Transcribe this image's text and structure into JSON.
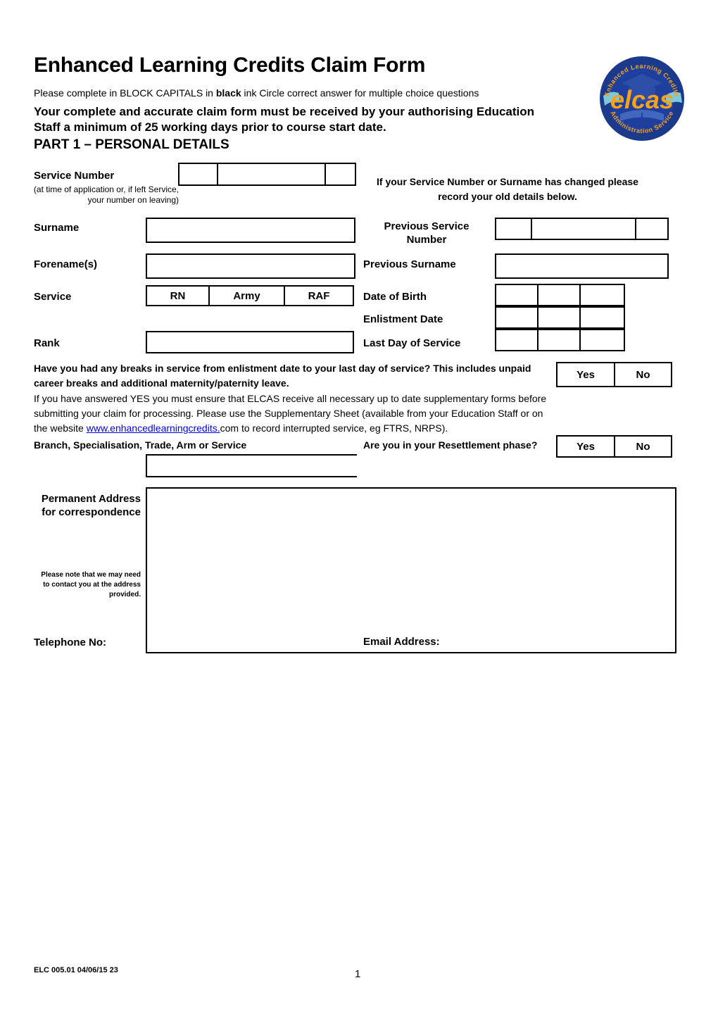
{
  "document": {
    "title": "Enhanced Learning Credits Claim Form",
    "subtitle_part1": "Please complete in BLOCK CAPITALS in ",
    "subtitle_bold": "black",
    "subtitle_part2": " ink Circle correct answer for multiple choice questions",
    "notice": "Your complete and accurate claim form must be received by your authorising Education Staff a minimum of 25 working days prior to course start date.",
    "part_heading": "PART 1 – PERSONAL DETAILS"
  },
  "logo": {
    "name": "elcas-logo",
    "center_text": "elcas",
    "ring_top_text": "Enhanced Learning Credits",
    "ring_bottom_text": "Administration Service",
    "colors": {
      "ring": "#1b3a8c",
      "ring_text": "#f5a21c",
      "disc": "#1e3f9e",
      "center_text": "#f5a21c",
      "cap": "#2d4fa8",
      "book": "#7fcad8"
    }
  },
  "left_column": {
    "service_number_label": "Service Number",
    "service_number_note": "(at time of application or, if left Service, your number on leaving)",
    "surname_label": "Surname",
    "forenames_label": "Forename(s)",
    "service_label": "Service",
    "service_options": [
      "RN",
      "Army",
      "RAF"
    ],
    "rank_label": "Rank"
  },
  "right_column": {
    "changed_notice": "If your Service Number or Surname has changed please record your old details below.",
    "previous_service_number_label": "Previous Service Number",
    "previous_surname_label": "Previous Surname",
    "date_of_birth_label": "Date of Birth",
    "enlistment_date_label": "Enlistment Date",
    "last_day_of_service_label": "Last Day of Service"
  },
  "breaks_section": {
    "question": "Have you had any breaks in service from enlistment date to your last day of service?  This includes unpaid career breaks and additional maternity/paternity leave.",
    "yes_label": "Yes",
    "no_label": "No",
    "guidance_line1": "If you have answered YES you must ensure that ELCAS receive all necessary up to date supplementary forms before",
    "guidance_line2": "submitting your claim for processing.  Please use the Supplementary Sheet (available from your Education Staff or on",
    "guidance_line3_pre": "the website ",
    "guidance_link": "www.enhancedlearningcredits.",
    "guidance_line3_post": "com to record interrupted service, eg FTRS, NRPS)."
  },
  "branch_section": {
    "branch_label": "Branch, Specialisation, Trade, Arm or Service",
    "resettlement_question": "Are you in your Resettlement phase?",
    "yes_label": "Yes",
    "no_label": "No"
  },
  "address_section": {
    "address_label": "Permanent Address for correspondence",
    "address_note": "Please note that we may need to contact you at the address provided.",
    "telephone_label": "Telephone No:",
    "email_label": "Email Address:"
  },
  "footer": {
    "code": "ELC 005.01 04/06/15 23",
    "page_number": "1"
  }
}
